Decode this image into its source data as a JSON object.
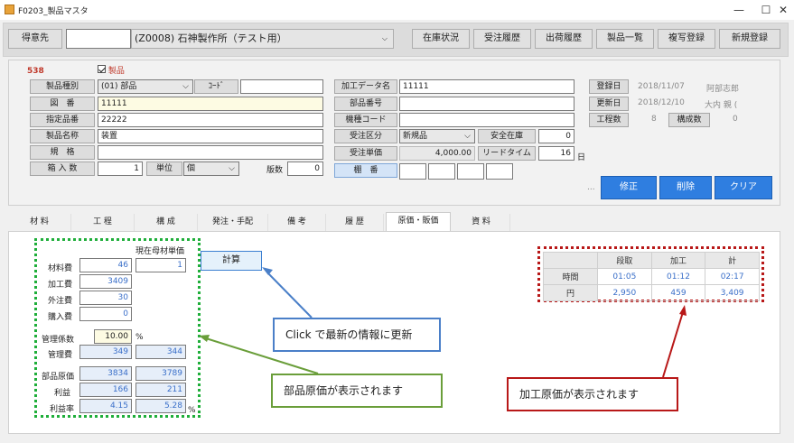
{
  "window": {
    "title": "F0203_製品マスタ",
    "minimize": "—",
    "maximize": "☐",
    "close": "✕"
  },
  "top": {
    "customer_label": "得意先",
    "customer_code": "",
    "customer_name": "(Z0008) 石神製作所（テスト用）",
    "buttons": [
      "在庫状況",
      "受注履歴",
      "出荷履歴",
      "製品一覧",
      "複写登録",
      "新規登録"
    ]
  },
  "form": {
    "red_code": "538",
    "product_checkbox": "製品",
    "type_label": "製品種別",
    "type_value": "(01) 部品",
    "code_label": "ｺｰﾄﾞ",
    "code_value": "",
    "drawing_label": "図　番",
    "drawing_value": "11111",
    "specified_label": "指定品番",
    "specified_value": "22222",
    "name_label": "製品名称",
    "name_value": "装置",
    "spec_label": "規　格",
    "spec_value": "",
    "boxqty_label": "箱 入 数",
    "boxqty_value": "1",
    "unit_label": "単位",
    "unit_value": "個",
    "plate_label": "版数",
    "plate_value": "0",
    "proc_data_label": "加工データ名",
    "proc_data_value": "11111",
    "part_no_label": "部品番号",
    "part_no_value": "",
    "machine_code_label": "機種コード",
    "machine_code_value": "",
    "order_class_label": "受注区分",
    "order_class_value": "新規品",
    "safety_stock_label": "安全在庫",
    "safety_stock_value": "0",
    "order_price_label": "受注単価",
    "order_price_value": "4,000.00",
    "lead_time_label": "リードタイム",
    "lead_time_value": "16",
    "lead_time_unit": "日",
    "shelf_label": "棚　番",
    "reg_date_label": "登録日",
    "reg_date_value": "2018/11/07",
    "reg_user": "阿部志郎",
    "upd_date_label": "更新日",
    "upd_date_value": "2018/12/10",
    "upd_user": "大内 親 (",
    "process_count_label": "工程数",
    "process_count_value": "8",
    "comp_count_label": "構成数",
    "comp_count_value": "0",
    "ellipsis": "...",
    "actions": {
      "edit": "修正",
      "delete": "削除",
      "clear": "クリア"
    }
  },
  "tabs": [
    "材 料",
    "工 程",
    "構 成",
    "発注・手配",
    "備 考",
    "履 歴",
    "原価・販価",
    "資 料"
  ],
  "active_tab": 6,
  "cost": {
    "header_current": "現在母材単価",
    "rows": [
      {
        "label": "材料費",
        "v1": "46",
        "v2": "1"
      },
      {
        "label": "加工費",
        "v1": "3409"
      },
      {
        "label": "外注費",
        "v1": "30"
      },
      {
        "label": "購入費",
        "v1": "0"
      }
    ],
    "mgmt_rate_label": "管理係数",
    "mgmt_rate_value": "10.00",
    "mgmt_rate_unit": "%",
    "mgmt_cost_label": "管理費",
    "mgmt_cost_v1": "349",
    "mgmt_cost_v2": "344",
    "part_cost_label": "部品原価",
    "part_cost_v1": "3834",
    "part_cost_v2": "3789",
    "profit_label": "利益",
    "profit_v1": "166",
    "profit_v2": "211",
    "profit_rate_label": "利益率",
    "profit_rate_v1": "4.15",
    "profit_rate_v2": "5.28",
    "profit_rate_unit": "%",
    "calc_button": "計算"
  },
  "proc_table": {
    "headers": [
      "段取",
      "加工",
      "計"
    ],
    "rows": [
      {
        "label": "時間",
        "values": [
          "01:05",
          "01:12",
          "02:17"
        ]
      },
      {
        "label": "円",
        "values": [
          "2,950",
          "459",
          "3,409"
        ]
      }
    ]
  },
  "callouts": {
    "click": "Click で最新の情報に更新",
    "part_cost": "部品原価が表示されます",
    "proc_cost": "加工原価が表示されます"
  },
  "colors": {
    "green": "#1fae3a",
    "red": "#b81818",
    "blue_arrow": "#4a7fc8"
  }
}
